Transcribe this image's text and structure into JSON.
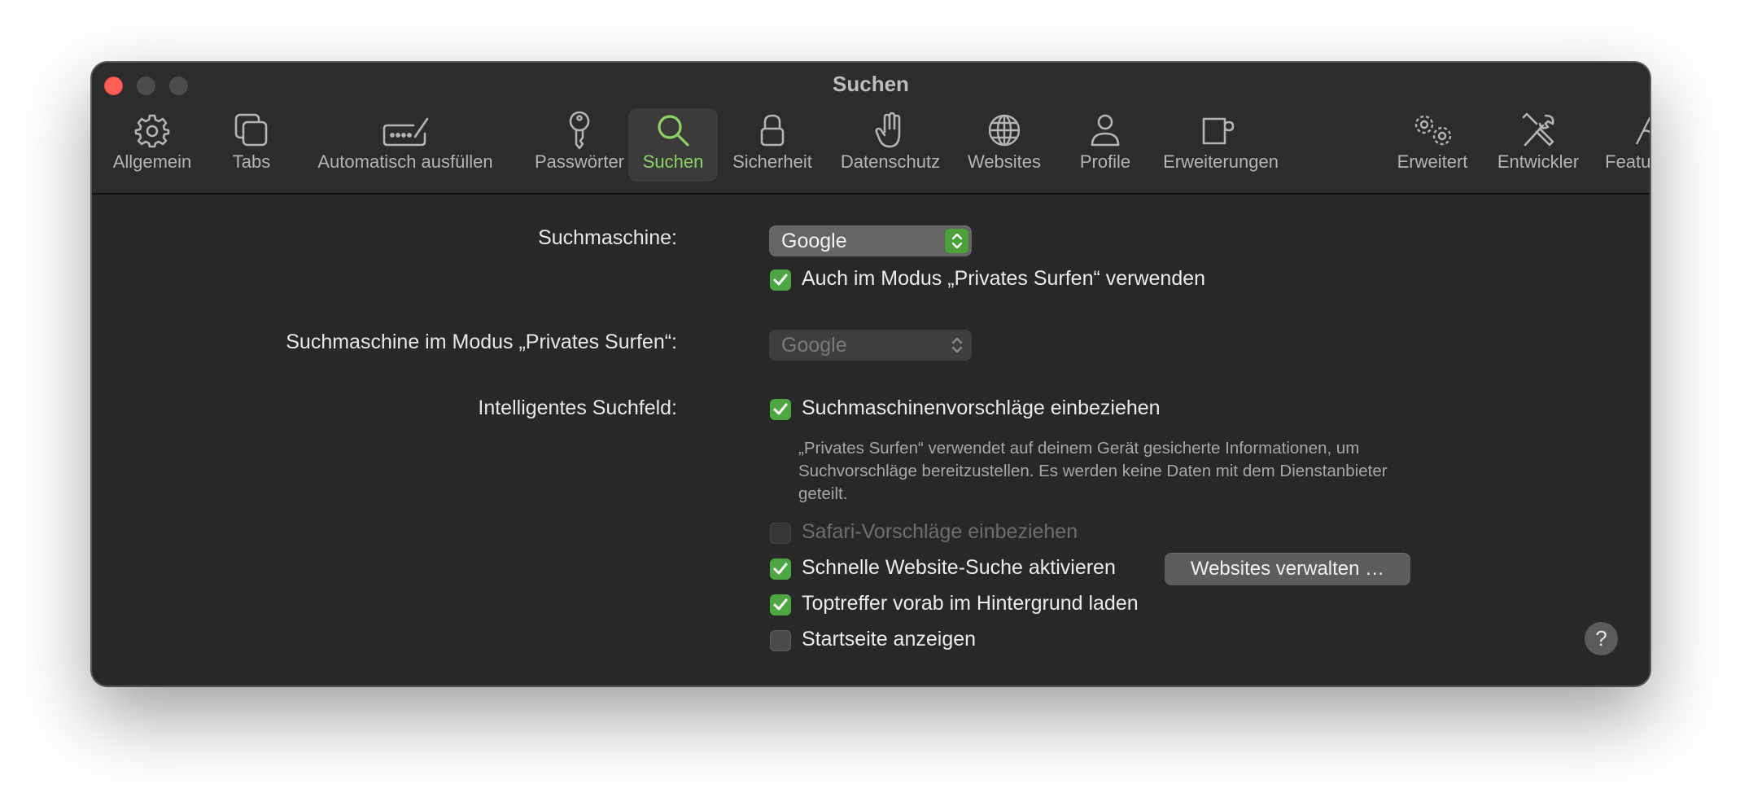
{
  "window": {
    "title": "Suchen"
  },
  "toolbar": {
    "tabs": [
      {
        "label": "Allgemein",
        "icon": "gear-icon"
      },
      {
        "label": "Tabs",
        "icon": "tabs-icon"
      },
      {
        "label": "Automatisch ausfüllen",
        "icon": "autofill-icon"
      },
      {
        "label": "Passwörter",
        "icon": "key-icon"
      },
      {
        "label": "Suchen",
        "icon": "search-icon",
        "selected": true
      },
      {
        "label": "Sicherheit",
        "icon": "lock-icon"
      },
      {
        "label": "Datenschutz",
        "icon": "hand-icon"
      },
      {
        "label": "Websites",
        "icon": "globe-icon"
      },
      {
        "label": "Profile",
        "icon": "person-icon"
      },
      {
        "label": "Erweiterungen",
        "icon": "puzzle-icon"
      },
      {
        "label": "Erweitert",
        "icon": "gears-icon"
      },
      {
        "label": "Entwickler",
        "icon": "tools-icon"
      },
      {
        "label": "Feature Flags",
        "icon": "flags-icon"
      }
    ]
  },
  "search": {
    "engine_label": "Suchmaschine:",
    "engine_value": "Google",
    "private_also_label": "Auch im Modus „Privates Surfen“ verwenden",
    "private_also_checked": true,
    "private_engine_label": "Suchmaschine im Modus „Privates Surfen“:",
    "private_engine_value": "Google",
    "smart_field_label": "Intelligentes Suchfeld:",
    "suggestions_label": "Suchmaschinenvorschläge einbeziehen",
    "suggestions_checked": true,
    "private_note": "„Privates Surfen“ verwendet auf deinem Gerät gesicherte Informationen, um Suchvorschläge bereitzustellen. Es werden keine Daten mit dem Dienstanbieter geteilt.",
    "safari_suggestions_label": "Safari-Vorschläge einbeziehen",
    "safari_suggestions_checked": false,
    "quick_search_label": "Schnelle Website-Suche aktivieren",
    "quick_search_checked": true,
    "manage_websites_button": "Websites verwalten …",
    "preload_label": "Toptreffer vorab im Hintergrund laden",
    "preload_checked": true,
    "start_page_label": "Startseite anzeigen",
    "start_page_checked": false
  },
  "help_label": "?",
  "colors": {
    "accent": "#8cd264",
    "checkbox": "#4ca642",
    "window_bg": "#282828",
    "close": "#fe5f57"
  }
}
